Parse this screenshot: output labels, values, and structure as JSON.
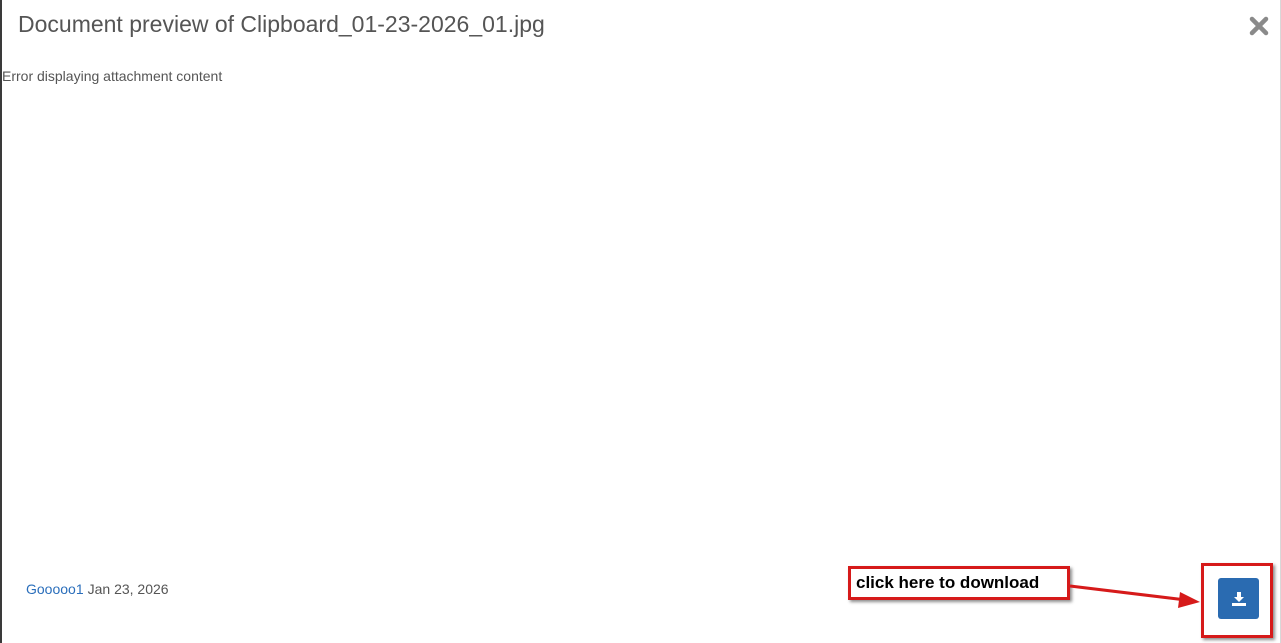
{
  "dialog": {
    "title": "Document preview of Clipboard_01-23-2026_01.jpg",
    "close_icon": "close-icon",
    "error_message": "Error displaying attachment content"
  },
  "footer": {
    "user": "Gooooo1",
    "date": "Jan 23, 2026",
    "download_icon": "download-icon"
  },
  "annotation": {
    "callout_text": "click here to download",
    "color": "#d61a1a"
  },
  "colors": {
    "accent": "#2a6bb1",
    "link": "#2a6ebb",
    "text": "#555555"
  }
}
